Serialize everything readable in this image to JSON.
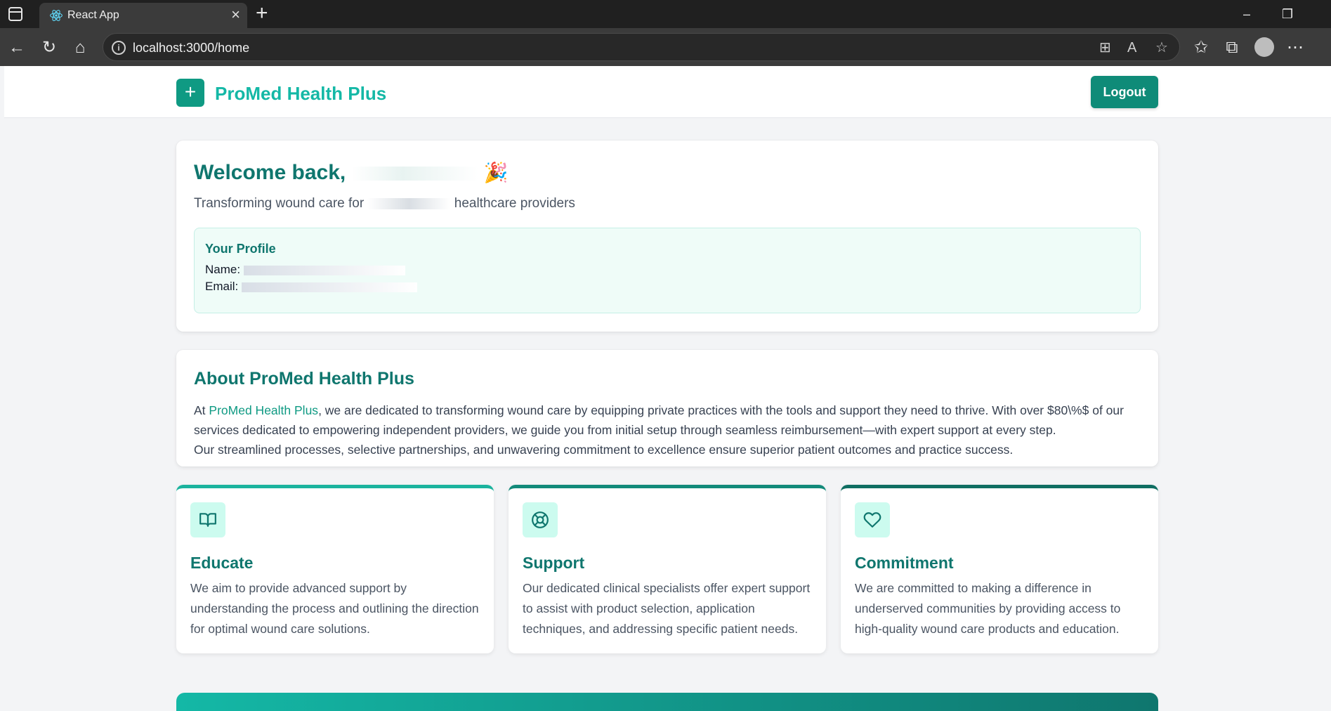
{
  "browser": {
    "tab_title": "React App",
    "url": "localhost:3000/home"
  },
  "header": {
    "brand": "ProMed Health Plus",
    "logout_label": "Logout"
  },
  "welcome": {
    "title": "Welcome back,",
    "emoji": "🎉",
    "subtitle_prefix": "Transforming wound care for",
    "subtitle_suffix": "healthcare providers",
    "profile": {
      "title": "Your Profile",
      "name_label": "Name:",
      "email_label": "Email:"
    }
  },
  "about": {
    "title": "About ProMed Health Plus",
    "p1_prefix": "At",
    "p1_highlight": "ProMed Health Plus",
    "p1_rest": ", we are dedicated to transforming wound care by equipping private practices with the tools and support they need to thrive. With over $80\\%$ of our services dedicated to empowering independent providers, we guide you from initial setup through seamless reimbursement—with expert support at every step.",
    "p2": "Our streamlined processes, selective partnerships, and unwavering commitment to excellence ensure superior patient outcomes and practice success."
  },
  "features": [
    {
      "title": "Educate",
      "icon": "book-icon",
      "text": "We aim to provide advanced support by understanding the process and outlining the direction for optimal wound care solutions."
    },
    {
      "title": "Support",
      "icon": "lifebuoy-icon",
      "text": "Our dedicated clinical specialists offer expert support to assist with product selection, application techniques, and addressing specific patient needs."
    },
    {
      "title": "Commitment",
      "icon": "heart-icon",
      "text": "We are committed to making a difference in underserved communities by providing access to high-quality wound care products and education."
    }
  ],
  "colors": {
    "brand": "#14b8a6",
    "brand_dark": "#0f766e",
    "button": "#0f8b78",
    "icon_bg": "#ccfbef",
    "profile_bg": "#effcf8"
  }
}
